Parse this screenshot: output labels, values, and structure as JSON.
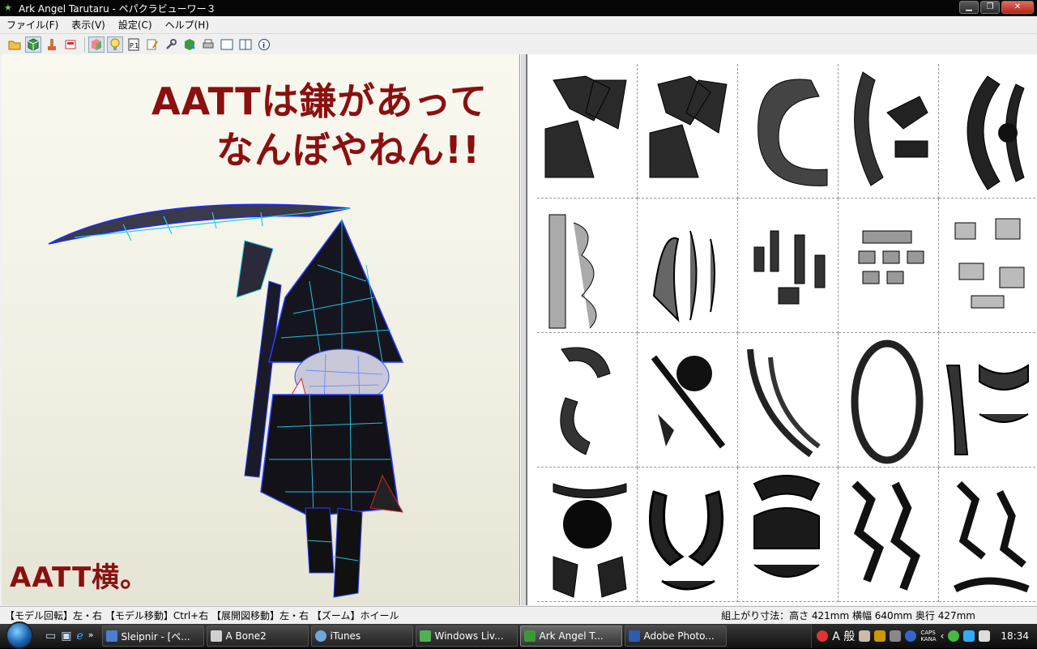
{
  "window": {
    "title": "Ark Angel Tarutaru - ペパクラビューワー３"
  },
  "menu": [
    {
      "label": "ファイル(F)"
    },
    {
      "label": "表示(V)"
    },
    {
      "label": "設定(C)"
    },
    {
      "label": "ヘルプ(H)"
    }
  ],
  "toolbar": {
    "icons": [
      "open-folder-icon",
      "3d-view-icon",
      "brush-icon",
      "print-preview-icon",
      "texture-icon",
      "light-icon",
      "page-number-icon",
      "edit-icon",
      "wrench-icon",
      "export-icon",
      "printer-icon",
      "single-pane-icon",
      "dual-pane-icon",
      "info-icon"
    ]
  },
  "canvas_text": {
    "line1": "AATTは鎌があって",
    "line2": "なんぼやねん!!",
    "caption": "AATT横。"
  },
  "status": {
    "left": "【モデル回転】左・右 【モデル移動】Ctrl+右 【展開図移動】左・右 【ズーム】ホイール",
    "right": "組上がり寸法：高さ 421mm 横幅 640mm 奥行 427mm"
  },
  "taskbar": {
    "tasks": [
      {
        "label": "Sleipnir - [ペ...",
        "color": "#4a7fd0"
      },
      {
        "label": "A Bone2",
        "color": "#d0d0d0"
      },
      {
        "label": "iTunes",
        "color": "#6fa8dc"
      },
      {
        "label": "Windows Liv...",
        "color": "#52b052"
      },
      {
        "label": "Ark Angel T...",
        "color": "#3a9a3a"
      },
      {
        "label": "Adobe Photo...",
        "color": "#2a5db0"
      }
    ],
    "tray": {
      "ime": "A 般",
      "caps": "CAPS",
      "kana": "KANA",
      "clock": "18:34"
    }
  }
}
